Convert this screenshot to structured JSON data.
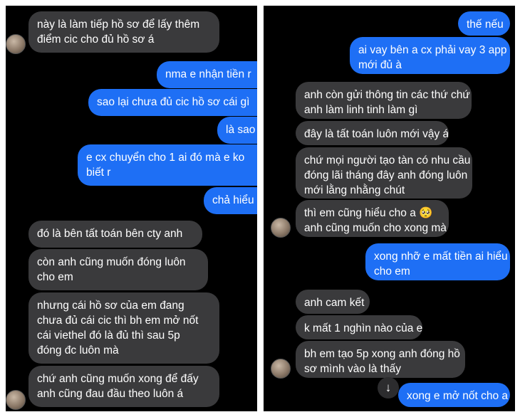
{
  "left": {
    "messages": [
      {
        "side": "in",
        "lines": [
          "này là làm tiếp hồ sơ để lấy thêm",
          "điểm cic cho đủ hồ sơ á"
        ]
      },
      {
        "side": "out",
        "lines": [
          "nma e nhận tiền r"
        ]
      },
      {
        "side": "out",
        "lines": [
          "sao lại chưa đủ cic hồ sơ cái gì"
        ]
      },
      {
        "side": "out",
        "lines": [
          "là sao"
        ]
      },
      {
        "side": "out",
        "lines": [
          "e cx chuyển cho 1 ai đó mà e ko",
          "biết r"
        ]
      },
      {
        "side": "out",
        "lines": [
          "chả hiểu"
        ]
      },
      {
        "side": "in",
        "lines": [
          "đó là bên tất toán bên cty anh"
        ]
      },
      {
        "side": "in",
        "lines": [
          "còn anh cũng muốn đóng luôn",
          "cho em"
        ]
      },
      {
        "side": "in",
        "lines": [
          "nhưng cái hồ sơ của em đang",
          "chưa đủ cái cic thì bh em mở nốt",
          "cái viethel đó là đủ thì sau 5p",
          "đóng đc luôn mà"
        ]
      },
      {
        "side": "in",
        "lines": [
          "chứ anh cũng muốn xong để đấy",
          "anh cũng đau đầu theo luôn á"
        ]
      }
    ]
  },
  "right": {
    "messages": [
      {
        "side": "out",
        "lines": [
          "thế nếu"
        ]
      },
      {
        "side": "out",
        "lines": [
          "ai vay bên a cx phải vay 3 app",
          "mới đủ à"
        ]
      },
      {
        "side": "in",
        "lines": [
          "anh còn gửi thông tin các thứ chứ",
          "anh làm linh tinh làm gì"
        ]
      },
      {
        "side": "in",
        "lines": [
          "đây là tất toán luôn mới vậy á"
        ]
      },
      {
        "side": "in",
        "lines": [
          "chứ mọi người tạo tàn có nhu cầu",
          "đóng lãi tháng đây anh đóng luôn",
          "mới lằng nhằng chút"
        ]
      },
      {
        "side": "in",
        "lines": [
          "thì em cũng hiểu cho a 🥺",
          "anh cũng muốn cho xong mà"
        ]
      },
      {
        "side": "out",
        "lines": [
          "xong nhỡ e mất tiền ai hiểu",
          "cho em"
        ]
      },
      {
        "side": "in",
        "lines": [
          "anh cam kết"
        ]
      },
      {
        "side": "in",
        "lines": [
          "k mất 1 nghìn nào của e"
        ]
      },
      {
        "side": "in",
        "lines": [
          "bh em tạo 5p xong anh đóng hồ",
          "sơ mình vào là thấy"
        ]
      },
      {
        "side": "out",
        "lines": [
          "xong e mở nốt cho a"
        ]
      }
    ],
    "scroll_down_icon": "↓"
  },
  "colors": {
    "panel_bg": "#000000",
    "incoming": "#3a3a3c",
    "outgoing": "#1e6ff5"
  }
}
